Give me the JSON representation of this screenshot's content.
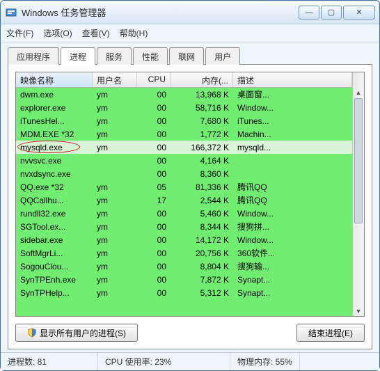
{
  "window": {
    "title": "Windows 任务管理器"
  },
  "menu": [
    "文件(F)",
    "选项(O)",
    "查看(V)",
    "帮助(H)"
  ],
  "tabs": [
    "应用程序",
    "进程",
    "服务",
    "性能",
    "联网",
    "用户"
  ],
  "active_tab": 1,
  "columns": {
    "image": "映像名称",
    "user": "用户名",
    "cpu": "CPU",
    "mem": "内存(...",
    "desc": "描述"
  },
  "rows": [
    {
      "img": "dwm.exe",
      "user": "ym",
      "cpu": "00",
      "mem": "13,968 K",
      "desc": "桌面窗..."
    },
    {
      "img": "explorer.exe",
      "user": "ym",
      "cpu": "00",
      "mem": "58,716 K",
      "desc": "Window..."
    },
    {
      "img": "iTunesHel...",
      "user": "ym",
      "cpu": "00",
      "mem": "7,680 K",
      "desc": "iTunes..."
    },
    {
      "img": "MDM.EXE *32",
      "user": "ym",
      "cpu": "00",
      "mem": "1,772 K",
      "desc": "Machin..."
    },
    {
      "img": "mysqld.exe",
      "user": "ym",
      "cpu": "00",
      "mem": "166,372 K",
      "desc": "mysqld...",
      "hl": true,
      "circle": true
    },
    {
      "img": "nvvsvc.exe",
      "user": "",
      "cpu": "00",
      "mem": "4,164 K",
      "desc": ""
    },
    {
      "img": "nvxdsync.exe",
      "user": "",
      "cpu": "00",
      "mem": "8,360 K",
      "desc": ""
    },
    {
      "img": "QQ.exe *32",
      "user": "ym",
      "cpu": "05",
      "mem": "81,336 K",
      "desc": "腾讯QQ"
    },
    {
      "img": "QQCallhu...",
      "user": "ym",
      "cpu": "17",
      "mem": "2,544 K",
      "desc": "腾讯QQ"
    },
    {
      "img": "rundll32.exe",
      "user": "ym",
      "cpu": "00",
      "mem": "5,460 K",
      "desc": "Window..."
    },
    {
      "img": "SGTool.ex...",
      "user": "ym",
      "cpu": "00",
      "mem": "8,344 K",
      "desc": "搜狗拼..."
    },
    {
      "img": "sidebar.exe",
      "user": "ym",
      "cpu": "00",
      "mem": "14,172 K",
      "desc": "Window..."
    },
    {
      "img": "SoftMgrLi...",
      "user": "ym",
      "cpu": "00",
      "mem": "20,756 K",
      "desc": "360软件..."
    },
    {
      "img": "SogouClou...",
      "user": "ym",
      "cpu": "00",
      "mem": "8,804 K",
      "desc": "搜狗输..."
    },
    {
      "img": "SynTPEnh.exe",
      "user": "ym",
      "cpu": "00",
      "mem": "7,872 K",
      "desc": "Synapt..."
    },
    {
      "img": "SynTPHelp...",
      "user": "ym",
      "cpu": "00",
      "mem": "5,312 K",
      "desc": "Synapt..."
    }
  ],
  "buttons": {
    "show_all": "显示所有用户的进程(S)",
    "end": "结束进程(E)"
  },
  "status": {
    "processes": "进程数: 81",
    "cpu": "CPU 使用率: 23%",
    "mem": "物理内存: 55%"
  }
}
